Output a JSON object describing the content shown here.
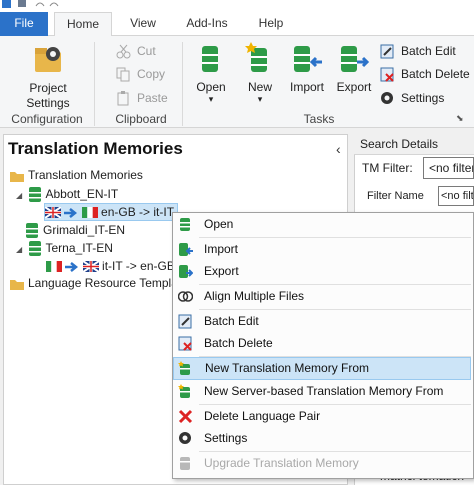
{
  "tabs": {
    "file": "File",
    "home": "Home",
    "view": "View",
    "addins": "Add-Ins",
    "help": "Help"
  },
  "ribbon": {
    "project_settings": "Project Settings",
    "configuration": "Configuration",
    "cut": "Cut",
    "copy": "Copy",
    "paste": "Paste",
    "clipboard": "Clipboard",
    "open": "Open",
    "new": "New",
    "import": "Import",
    "export": "Export",
    "batch_edit": "Batch Edit",
    "batch_delete": "Batch Delete",
    "settings": "Settings",
    "tasks": "Tasks"
  },
  "left_pane": {
    "title": "Translation Memories",
    "tree": {
      "root": "Translation Memories",
      "tm1": "Abbott_EN-IT",
      "tm1_pair": "en-GB -> it-IT",
      "tm2": "Grimaldi_IT-EN",
      "tm3": "Terna_IT-EN",
      "tm3_pair": "it-IT -> en-GB",
      "lrt": "Language Resource Templates"
    }
  },
  "right_pane": {
    "title": "Search Details",
    "tm_filter": "TM Filter:",
    "tm_filter_value": "<no filter>",
    "filter_name": "Filter Name",
    "filter_name_value": "<no filter>",
    "bottom_text": "matrici tematich"
  },
  "context_menu": {
    "open": "Open",
    "import": "Import",
    "export": "Export",
    "align": "Align Multiple Files",
    "batch_edit": "Batch Edit",
    "batch_delete": "Batch Delete",
    "new_tm_from": "New Translation Memory From",
    "new_server_tm_from": "New Server-based Translation Memory From",
    "delete_pair": "Delete Language Pair",
    "settings": "Settings",
    "upgrade": "Upgrade Translation Memory"
  },
  "colors": {
    "accent": "#2b72c9",
    "highlight": "#cce4f7",
    "db_green": "#2e9b48"
  }
}
